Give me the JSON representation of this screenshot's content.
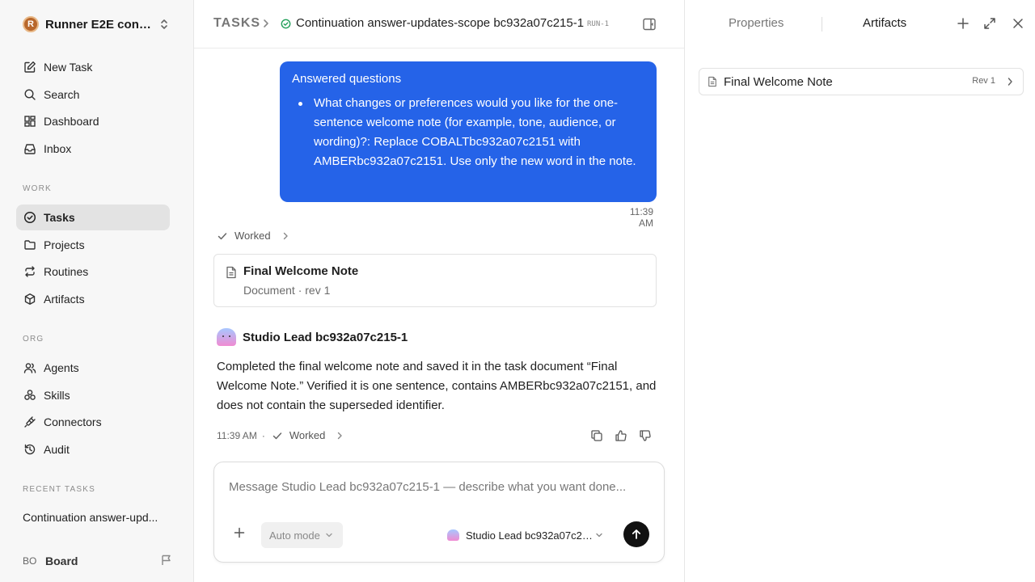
{
  "sidebar": {
    "workspace_initial": "R",
    "workspace_name": "Runner E2E conti...",
    "nav_top": [
      {
        "label": "New Task",
        "icon": "edit-icon"
      },
      {
        "label": "Search",
        "icon": "search-icon"
      },
      {
        "label": "Dashboard",
        "icon": "dashboard-icon"
      },
      {
        "label": "Inbox",
        "icon": "inbox-icon"
      }
    ],
    "work_label": "WORK",
    "nav_work": [
      {
        "label": "Tasks",
        "icon": "check-circle-icon",
        "active": true
      },
      {
        "label": "Projects",
        "icon": "folder-icon"
      },
      {
        "label": "Routines",
        "icon": "repeat-icon"
      },
      {
        "label": "Artifacts",
        "icon": "box-icon"
      }
    ],
    "org_label": "ORG",
    "nav_org": [
      {
        "label": "Agents",
        "icon": "users-icon"
      },
      {
        "label": "Skills",
        "icon": "skills-icon"
      },
      {
        "label": "Connectors",
        "icon": "plug-icon"
      },
      {
        "label": "Audit",
        "icon": "history-icon"
      }
    ],
    "recent_label": "RECENT TASKS",
    "recent_task": "Continuation answer-upd...",
    "board_initials": "BO",
    "board_label": "Board"
  },
  "header": {
    "root": "TASKS",
    "title": "Continuation answer-updates-scope bc932a07c215-1",
    "run_tag": "RUN-1"
  },
  "conversation": {
    "bubble_title": "Answered questions",
    "bubble_item": "What changes or preferences would you like for the one-sentence welcome note (for example, tone, audience, or wording)?: Replace COBALTbc932a07c2151 with AMBERbc932a07c2151. Use only the new word in the note.",
    "bubble_time": "11:39 AM",
    "worked_label": "Worked",
    "doc_title": "Final Welcome Note",
    "doc_sub": "Document · rev 1",
    "agent_name": "Studio Lead bc932a07c215-1",
    "agent_message": "Completed the final welcome note and saved it in the task document “Final Welcome Note.” Verified it is one sentence, contains AMBERbc932a07c2151, and does not contain the superseded identifier.",
    "agent_time": "11:39 AM",
    "agent_worked_label": "Worked"
  },
  "composer": {
    "placeholder": "Message Studio Lead bc932a07c215-1 — describe what you want done...",
    "mode_label": "Auto mode",
    "agent_select": "Studio Lead bc932a07c21..."
  },
  "right_panel": {
    "tab_properties": "Properties",
    "tab_artifacts": "Artifacts",
    "artifact_name": "Final Welcome Note",
    "artifact_rev": "Rev 1"
  },
  "colors": {
    "accent": "#2563e8",
    "active_nav": "#e3e3e3",
    "status_green": "#22a05a"
  }
}
